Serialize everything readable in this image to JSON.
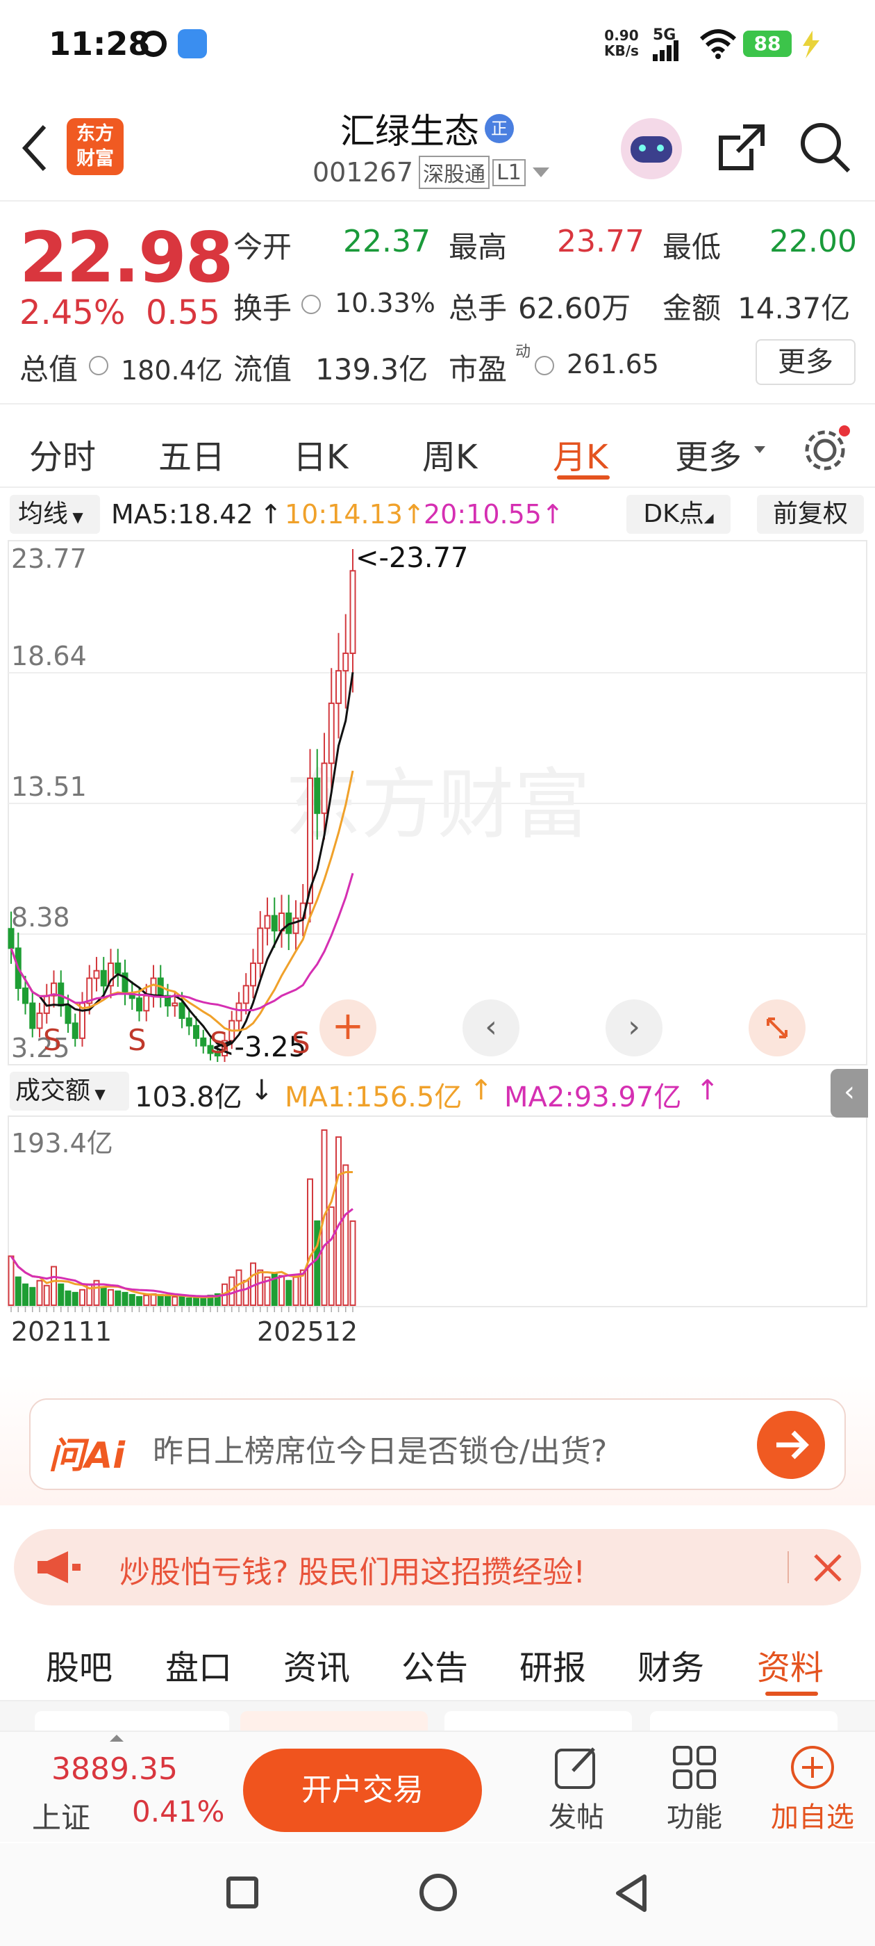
{
  "status_bar": {
    "time": "11:28",
    "net_speed": "0.90",
    "net_unit": "KB/s",
    "signal": "5G",
    "battery": "88"
  },
  "header": {
    "logo_line1": "东方",
    "logo_line2": "财富",
    "stock_name": "汇绿生态",
    "badge": "正",
    "code": "001267",
    "market_tag": "深股通",
    "level_tag": "L1"
  },
  "quote": {
    "price": "22.98",
    "change_pct": "2.45%",
    "change": "0.55",
    "open_label": "今开",
    "open": "22.37",
    "high_label": "最高",
    "high": "23.77",
    "low_label": "最低",
    "low": "22.00",
    "turnover_label": "换手",
    "turnover": "10.33%",
    "volume_label": "总手",
    "volume": "62.60万",
    "amount_label": "金额",
    "amount": "14.37亿",
    "mktcap_label": "总值",
    "mktcap": "180.4亿",
    "float_label": "流值",
    "float": "139.3亿",
    "pe_label": "市盈",
    "pe_sup": "动",
    "pe": "261.65",
    "more": "更多"
  },
  "tabs": {
    "t1": "分时",
    "t2": "五日",
    "t3": "日K",
    "t4": "周K",
    "t5": "月K",
    "t6": "更多"
  },
  "ma_row": {
    "label": "均线",
    "ma5": "MA5:18.42",
    "ma10": "10:14.13",
    "ma20": "20:10.55",
    "dk": "DK点",
    "fq": "前复权"
  },
  "chart": {
    "y_labels": [
      "23.77",
      "18.64",
      "13.51",
      "8.38",
      "3.25"
    ],
    "high_note": "<-23.77",
    "low_note": "<-3.25",
    "signal_marks": [
      "S",
      "S",
      "S",
      "S"
    ],
    "watermark": "东方财富",
    "vol_label": "成交额",
    "vol_value": "103.8亿",
    "vol_ma1": "MA1:156.5亿",
    "vol_ma2": "MA2:93.97亿",
    "vol_max": "193.4亿",
    "x_start": "202111",
    "x_end": "202512",
    "colors": {
      "up": "#d33a3f",
      "down": "#1e9e34",
      "ma5": "#111111",
      "ma10": "#f0a12a",
      "ma20": "#d52fb2"
    }
  },
  "chart_data": {
    "type": "candlestick",
    "ylim": [
      3.25,
      23.77
    ],
    "high": 23.77,
    "low": 3.25,
    "period": [
      "202111",
      "202512"
    ]
  },
  "ai_box": {
    "logo": "问Ai",
    "prompt": "昨日上榜席位今日是否锁仓/出货?"
  },
  "ad": {
    "text": "炒股怕亏钱? 股民们用这招攒经验!"
  },
  "info_tabs": [
    "股吧",
    "盘口",
    "资讯",
    "公告",
    "研报",
    "财务",
    "资料"
  ],
  "bottom": {
    "index_value": "3889.35",
    "index_name": "上证",
    "index_pct": "0.41%",
    "trade": "开户交易",
    "post": "发帖",
    "func": "功能",
    "add": "加自选"
  }
}
